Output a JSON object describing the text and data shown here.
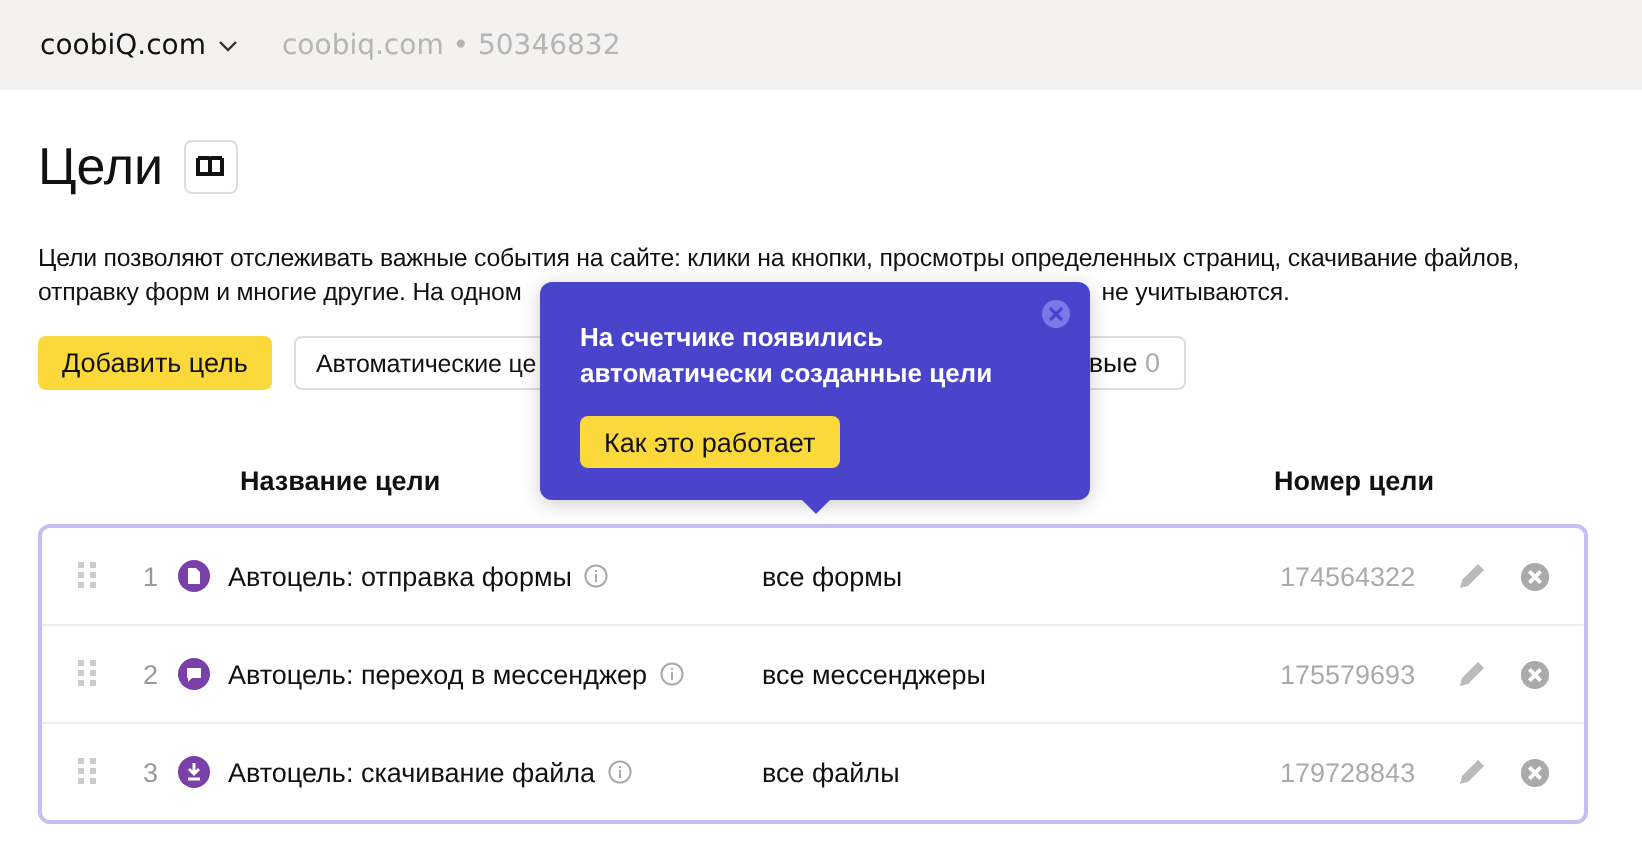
{
  "header": {
    "site": "coobiQ.com",
    "counter": "coobiq.com • 50346832"
  },
  "title": "Цели",
  "description": {
    "line_1": "Цели позволяют отслеживать важные события на сайте: клики на кнопки, просмотры определенных страниц, скачивание файлов,",
    "line_2_start": "отправку форм и многие другие. На одном",
    "line_2_end": "не учитываются."
  },
  "buttons": {
    "add": "Добавить цель",
    "filter_1": "Автоматические це",
    "filter_2": "вые",
    "filter_2_count": "0"
  },
  "popover": {
    "text": "На счетчике появились автоматически созданные цели",
    "action": "Как это работает"
  },
  "table": {
    "columns": {
      "name": "Название цели",
      "id": "Номер цели"
    },
    "rows": [
      {
        "index": "1",
        "kind": "form",
        "name": "Автоцель: отправка формы",
        "condition": "все формы",
        "id": "174564322"
      },
      {
        "index": "2",
        "kind": "messenger",
        "name": "Автоцель: переход в мессенджер",
        "condition": "все мессенджеры",
        "id": "175579693"
      },
      {
        "index": "3",
        "kind": "download",
        "name": "Автоцель: скачивание файла",
        "condition": "все файлы",
        "id": "179728843"
      }
    ]
  }
}
